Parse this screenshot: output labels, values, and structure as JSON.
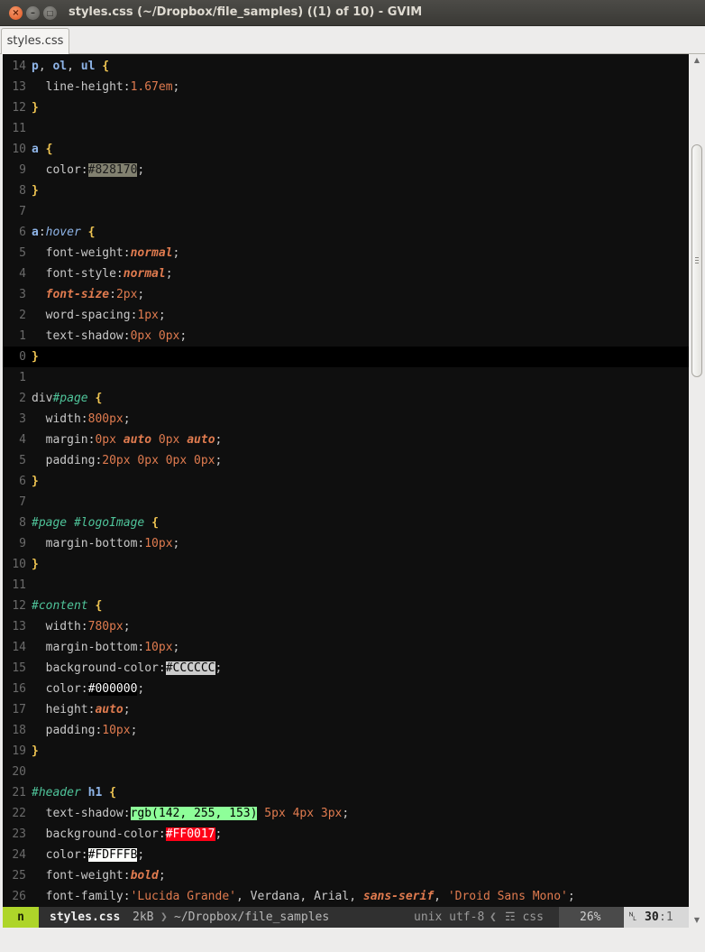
{
  "window": {
    "title": "styles.css (~/Dropbox/file_samples) ((1) of 10) - GVIM",
    "close_glyph": "×",
    "min_glyph": "–",
    "max_glyph": "□"
  },
  "tabs": [
    {
      "label": "styles.css"
    }
  ],
  "editor": {
    "line_numbers": [
      "14",
      "13",
      "12",
      "11",
      "10",
      "9",
      "8",
      "7",
      "6",
      "5",
      "4",
      "3",
      "2",
      "1",
      "0",
      "1",
      "2",
      "3",
      "4",
      "5",
      "6",
      "7",
      "8",
      "9",
      "10",
      "11",
      "12",
      "13",
      "14",
      "15",
      "16",
      "17",
      "18",
      "19",
      "20",
      "21",
      "22",
      "23",
      "24",
      "25",
      "26"
    ],
    "lines": [
      [
        [
          "p",
          "sel"
        ],
        [
          ", ",
          "punc"
        ],
        [
          "ol",
          "sel"
        ],
        [
          ", ",
          "punc"
        ],
        [
          "ul",
          "sel"
        ],
        [
          " ",
          "plain"
        ],
        [
          "{",
          "brace"
        ]
      ],
      [
        [
          "  line-height",
          "prop"
        ],
        [
          ":",
          "punc"
        ],
        [
          "1.67em",
          "num"
        ],
        [
          ";",
          "punc"
        ]
      ],
      [
        [
          "}",
          "brace"
        ]
      ],
      [],
      [
        [
          "a",
          "sel"
        ],
        [
          " ",
          "plain"
        ],
        [
          "{",
          "brace"
        ]
      ],
      [
        [
          "  color",
          "prop"
        ],
        [
          ":",
          "punc"
        ],
        [
          "#828170",
          "sw-828170"
        ],
        [
          ";",
          "punc"
        ]
      ],
      [
        [
          "}",
          "brace"
        ]
      ],
      [],
      [
        [
          "a",
          "sel"
        ],
        [
          ":",
          "punc"
        ],
        [
          "hover",
          "pseudo"
        ],
        [
          " ",
          "plain"
        ],
        [
          "{",
          "brace"
        ]
      ],
      [
        [
          "  font-weight",
          "prop"
        ],
        [
          ":",
          "punc"
        ],
        [
          "normal",
          "kw"
        ],
        [
          ";",
          "punc"
        ]
      ],
      [
        [
          "  font-style",
          "prop"
        ],
        [
          ":",
          "punc"
        ],
        [
          "normal",
          "kw"
        ],
        [
          ";",
          "punc"
        ]
      ],
      [
        [
          "  ",
          "plain"
        ],
        [
          "font-size",
          "fs"
        ],
        [
          ":",
          "punc"
        ],
        [
          "2px",
          "num"
        ],
        [
          ";",
          "punc"
        ]
      ],
      [
        [
          "  word-spacing",
          "prop"
        ],
        [
          ":",
          "punc"
        ],
        [
          "1px",
          "num"
        ],
        [
          ";",
          "punc"
        ]
      ],
      [
        [
          "  text-shadow",
          "prop"
        ],
        [
          ":",
          "punc"
        ],
        [
          "0px 0px",
          "num"
        ],
        [
          ";",
          "punc"
        ]
      ],
      [
        [
          "}",
          "brace"
        ]
      ],
      [],
      [
        [
          "div",
          "tag"
        ],
        [
          "#page",
          "id"
        ],
        [
          " ",
          "plain"
        ],
        [
          "{",
          "brace"
        ]
      ],
      [
        [
          "  width",
          "prop"
        ],
        [
          ":",
          "punc"
        ],
        [
          "800px",
          "num"
        ],
        [
          ";",
          "punc"
        ]
      ],
      [
        [
          "  margin",
          "prop"
        ],
        [
          ":",
          "punc"
        ],
        [
          "0px ",
          "num"
        ],
        [
          "auto",
          "kw"
        ],
        [
          " 0px ",
          "num"
        ],
        [
          "auto",
          "kw"
        ],
        [
          ";",
          "punc"
        ]
      ],
      [
        [
          "  padding",
          "prop"
        ],
        [
          ":",
          "punc"
        ],
        [
          "20px 0px 0px 0px",
          "num"
        ],
        [
          ";",
          "punc"
        ]
      ],
      [
        [
          "}",
          "brace"
        ]
      ],
      [],
      [
        [
          "#page #logoImage",
          "id"
        ],
        [
          " ",
          "plain"
        ],
        [
          "{",
          "brace"
        ]
      ],
      [
        [
          "  margin-bottom",
          "prop"
        ],
        [
          ":",
          "punc"
        ],
        [
          "10px",
          "num"
        ],
        [
          ";",
          "punc"
        ]
      ],
      [
        [
          "}",
          "brace"
        ]
      ],
      [],
      [
        [
          "#content",
          "id"
        ],
        [
          " ",
          "plain"
        ],
        [
          "{",
          "brace"
        ]
      ],
      [
        [
          "  width",
          "prop"
        ],
        [
          ":",
          "punc"
        ],
        [
          "780px",
          "num"
        ],
        [
          ";",
          "punc"
        ]
      ],
      [
        [
          "  margin-bottom",
          "prop"
        ],
        [
          ":",
          "punc"
        ],
        [
          "10px",
          "num"
        ],
        [
          ";",
          "punc"
        ]
      ],
      [
        [
          "  background-color",
          "prop"
        ],
        [
          ":",
          "punc"
        ],
        [
          "#CCCCCC",
          "sw-cccccc"
        ],
        [
          ";",
          "punc"
        ]
      ],
      [
        [
          "  color",
          "prop"
        ],
        [
          ":",
          "punc"
        ],
        [
          "#000000",
          "sw-000000"
        ],
        [
          ";",
          "punc"
        ]
      ],
      [
        [
          "  height",
          "prop"
        ],
        [
          ":",
          "punc"
        ],
        [
          "auto",
          "kw"
        ],
        [
          ";",
          "punc"
        ]
      ],
      [
        [
          "  padding",
          "prop"
        ],
        [
          ":",
          "punc"
        ],
        [
          "10px",
          "num"
        ],
        [
          ";",
          "punc"
        ]
      ],
      [
        [
          "}",
          "brace"
        ]
      ],
      [],
      [
        [
          "#header",
          "id"
        ],
        [
          " ",
          "plain"
        ],
        [
          "h1",
          "h1"
        ],
        [
          " ",
          "plain"
        ],
        [
          "{",
          "brace"
        ]
      ],
      [
        [
          "  text-shadow",
          "prop"
        ],
        [
          ":",
          "punc"
        ],
        [
          "rgb(142, 255, 153)",
          "sw-rgb"
        ],
        [
          " 5px 4px 3px",
          "num"
        ],
        [
          ";",
          "punc"
        ]
      ],
      [
        [
          "  background-color",
          "prop"
        ],
        [
          ":",
          "punc"
        ],
        [
          "#FF0017",
          "sw-ff0017"
        ],
        [
          ";",
          "punc"
        ]
      ],
      [
        [
          "  color",
          "prop"
        ],
        [
          ":",
          "punc"
        ],
        [
          "#FDFFFB",
          "sw-fdfffb"
        ],
        [
          ";",
          "punc"
        ]
      ],
      [
        [
          "  font-weight",
          "prop"
        ],
        [
          ":",
          "punc"
        ],
        [
          "bold",
          "kw"
        ],
        [
          ";",
          "punc"
        ]
      ],
      [
        [
          "  font-family",
          "prop"
        ],
        [
          ":",
          "punc"
        ],
        [
          "'Lucida Grande'",
          "str"
        ],
        [
          ", Verdana, Arial, ",
          "plain"
        ],
        [
          "sans-serif",
          "kw"
        ],
        [
          ", ",
          "plain"
        ],
        [
          "'Droid Sans Mono'",
          "str"
        ],
        [
          ";",
          "punc"
        ]
      ]
    ],
    "cursor_line_index": 14
  },
  "statusline": {
    "mode": "n",
    "filename": "styles.css",
    "size": "2kB",
    "separator": "❯",
    "path": "~/Dropbox/file_samples",
    "format": "unix utf-8",
    "separator_left": "❮",
    "filetype": "css",
    "filetype_icon": "☶",
    "percent": "26%",
    "line_icon": "␤",
    "line": "30",
    "col": ":1"
  },
  "colors": {
    "editor_bg": "#0f0f0f",
    "mode_bg": "#aed52a"
  }
}
